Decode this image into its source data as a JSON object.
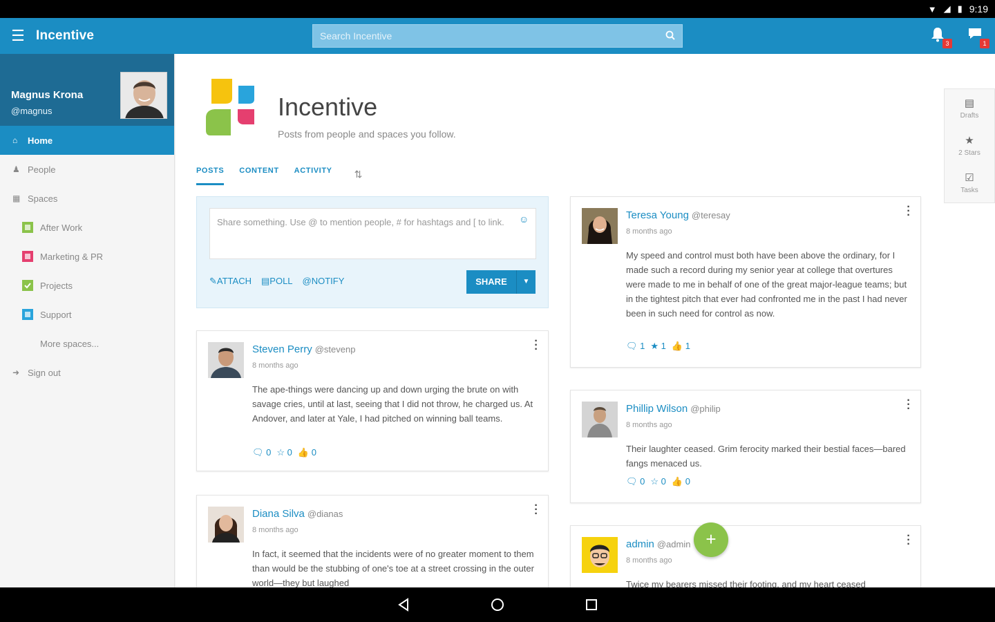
{
  "status_bar": {
    "time": "9:19"
  },
  "app": {
    "title": "Incentive",
    "search_placeholder": "Search Incentive",
    "notification_count": "3",
    "messages_count": "1"
  },
  "profile": {
    "name": "Magnus Krona",
    "handle": "@magnus"
  },
  "nav": {
    "home": "Home",
    "people": "People",
    "spaces": "Spaces",
    "after_work": "After Work",
    "marketing": "Marketing & PR",
    "projects": "Projects",
    "support": "Support",
    "more_spaces": "More spaces...",
    "sign_out": "Sign out"
  },
  "space_colors": {
    "after_work": "#8bc34a",
    "marketing": "#e53f6f",
    "projects": "#8bc34a",
    "support": "#29a4dc"
  },
  "brand": {
    "title": "Incentive",
    "subtitle": "Posts from people and spaces you follow."
  },
  "tabs": [
    "POSTS",
    "CONTENT",
    "ACTIVITY"
  ],
  "composer": {
    "placeholder": "Share something. Use @ to mention people, # for hashtags and [ to link.",
    "attach": "ATTACH",
    "poll": "POLL",
    "notify": "NOTIFY",
    "share": "SHARE"
  },
  "right_panel": {
    "drafts": "Drafts",
    "stars": "2 Stars",
    "tasks": "Tasks"
  },
  "posts": [
    {
      "name": "Steven Perry",
      "handle": "@stevenp",
      "time": "8 months ago",
      "body": "The ape-things were dancing up and down urging the brute on with savage cries, until at last, seeing that I did not throw, he charged us. At Andover, and later at Yale, I had pitched on winning ball teams.",
      "comments": "0",
      "stars": "0",
      "likes": "0"
    },
    {
      "name": "Diana Silva",
      "handle": "@dianas",
      "time": "8 months ago",
      "body": "In fact, it seemed that the incidents were of no greater moment to them than would be the stubbing of one's toe at a street crossing in the outer world—they but laughed"
    },
    {
      "name": "Teresa Young",
      "handle": "@teresay",
      "time": "8 months ago",
      "body": "My speed and control must both have been above the ordinary, for I made such a record during my senior year at college that overtures were made to me in behalf of one of the great major-league teams; but in the tightest pitch that ever had confronted me in the past I had never been in such need for control as now.",
      "comments": "1",
      "stars": "1",
      "likes": "1"
    },
    {
      "name": "Phillip Wilson",
      "handle": "@philip",
      "time": "8 months ago",
      "body": "Their laughter ceased. Grim ferocity marked their bestial faces—bared fangs menaced us.",
      "comments": "0",
      "stars": "0",
      "likes": "0"
    },
    {
      "name": "admin",
      "handle": "@admin",
      "time": "8 months ago",
      "body": "Twice my bearers missed their footing, and my heart ceased"
    }
  ]
}
